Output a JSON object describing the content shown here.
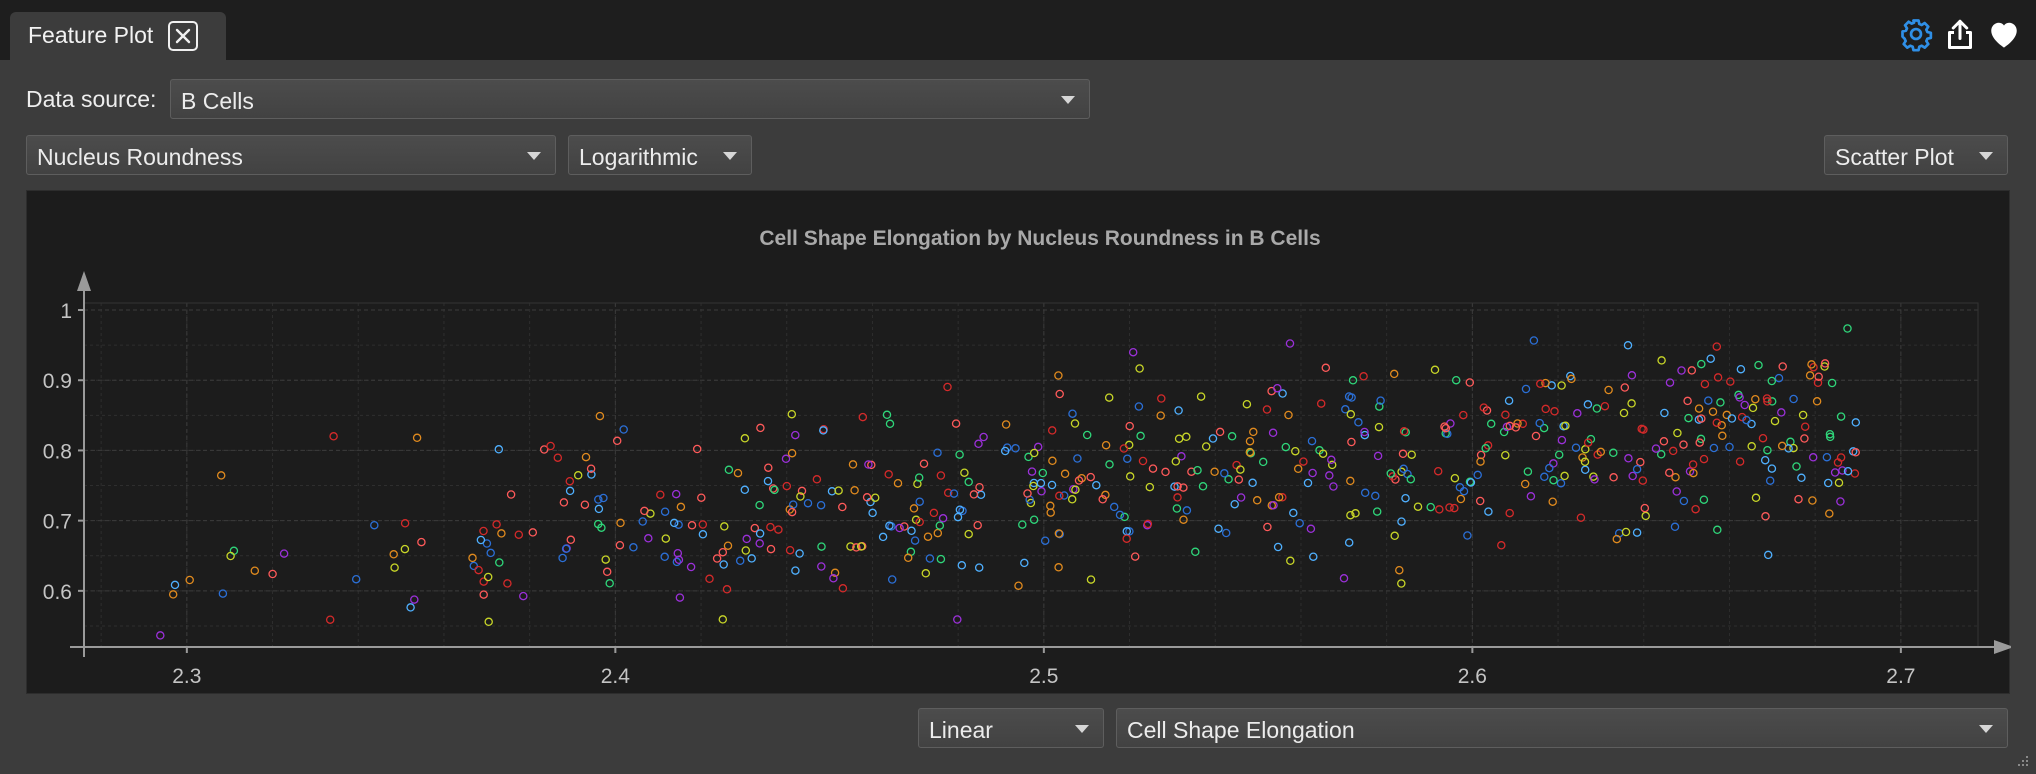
{
  "tab": {
    "title": "Feature Plot"
  },
  "toolbar": {
    "icons": [
      "settings-icon",
      "export-icon",
      "favorite-heart-icon"
    ],
    "accent": "#2f8fe6"
  },
  "data_source": {
    "label": "Data source:",
    "value": "B Cells"
  },
  "x_feature": {
    "value": "Nucleus Roundness"
  },
  "x_scale": {
    "value": "Logarithmic"
  },
  "plot_type": {
    "value": "Scatter Plot"
  },
  "y_scale": {
    "value": "Linear"
  },
  "y_feature": {
    "value": "Cell Shape Elongation"
  },
  "chart_data": {
    "type": "scatter",
    "title": "Cell Shape Elongation by Nucleus Roundness in B Cells",
    "xlabel": "",
    "ylabel": "",
    "x_ticks": [
      "2.3",
      "2.4",
      "2.5",
      "2.6",
      "2.7"
    ],
    "y_ticks": [
      "0.6",
      "0.7",
      "0.8",
      "0.9",
      "1"
    ],
    "xlim": [
      2.276,
      2.718
    ],
    "ylim": [
      0.52,
      1.01
    ],
    "grid": true,
    "marker": "hollow-circle",
    "colors": [
      "#d42a2a",
      "#2b6fd6",
      "#9b30d9",
      "#e08a1e",
      "#c8d628",
      "#2fd67a",
      "#ff5a5a",
      "#4fb0ff"
    ],
    "series": [
      {
        "seed": 17,
        "count": 620
      }
    ]
  }
}
